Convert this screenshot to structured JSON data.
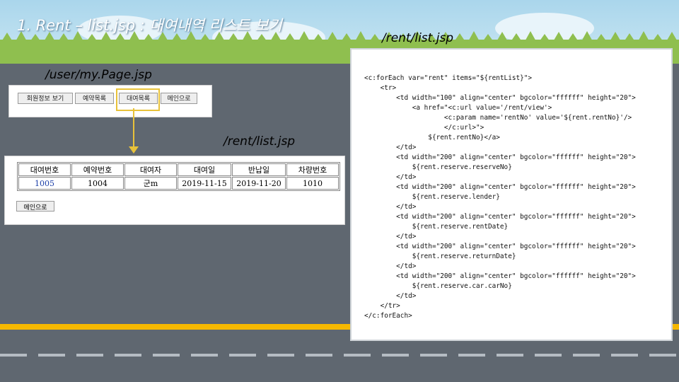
{
  "slide": {
    "title": "1. Rent – list.jsp : 대여내역 리스트 보기",
    "label_code": "/rent/list.jsp",
    "label_mypage": "/user/my.Page.jsp",
    "label_list": "/rent/list.jsp"
  },
  "mypage": {
    "buttons": [
      "회원정보 보기",
      "예약목록",
      "대여목록",
      "메인으로"
    ],
    "highlighted": "대여목록"
  },
  "rent_table": {
    "headers": [
      "대여번호",
      "예약번호",
      "대여자",
      "대여일",
      "반납일",
      "차량번호"
    ],
    "rows": [
      [
        "1005",
        "1004",
        "군m",
        "2019-11-15",
        "2019-11-20",
        "1010"
      ]
    ],
    "main_button": "메인으로"
  },
  "code_lines": [
    "<c:forEach var=\"rent\" items=\"${rentList}\">",
    "    <tr>",
    "        <td width=\"100\" align=\"center\" bgcolor=\"ffffff\" height=\"20\">",
    "            <a href=\"<c:url value='/rent/view'>",
    "                    <c:param name='rentNo' value='${rent.rentNo}'/>",
    "                    </c:url>\">",
    "                ${rent.rentNo}</a>",
    "        </td>",
    "        <td width=\"200\" align=\"center\" bgcolor=\"ffffff\" height=\"20\">",
    "            ${rent.reserve.reserveNo}",
    "        </td>",
    "        <td width=\"200\" align=\"center\" bgcolor=\"ffffff\" height=\"20\">",
    "            ${rent.reserve.lender}",
    "        </td>",
    "        <td width=\"200\" align=\"center\" bgcolor=\"ffffff\" height=\"20\">",
    "            ${rent.reserve.rentDate}",
    "        </td>",
    "        <td width=\"200\" align=\"center\" bgcolor=\"ffffff\" height=\"20\">",
    "            ${rent.reserve.returnDate}",
    "        </td>",
    "        <td width=\"200\" align=\"center\" bgcolor=\"ffffff\" height=\"20\">",
    "            ${rent.reserve.car.carNo}",
    "        </td>",
    "    </tr>",
    "</c:forEach>"
  ],
  "colors": {
    "highlight": "#e8c23a",
    "road_line": "#f5b800",
    "link": "#1c3fa8"
  }
}
